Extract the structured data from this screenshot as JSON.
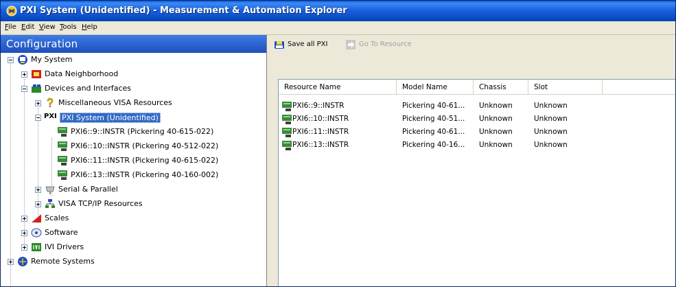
{
  "window": {
    "title": "PXI System (Unidentified) - Measurement & Automation Explorer"
  },
  "menu": {
    "items": [
      {
        "underline": "F",
        "rest": "ile"
      },
      {
        "underline": "E",
        "rest": "dit"
      },
      {
        "underline": "V",
        "rest": "iew"
      },
      {
        "underline": "T",
        "rest": "ools"
      },
      {
        "underline": "H",
        "rest": "elp"
      }
    ]
  },
  "config": {
    "header": "Configuration"
  },
  "toolbar": {
    "save_label": "Save all PXI",
    "goto_label": "Go To Resource"
  },
  "tree": {
    "items": [
      {
        "label": "My System",
        "icon": "computer-icon"
      },
      {
        "label": "Data Neighborhood",
        "icon": "data-neighborhood-icon"
      },
      {
        "label": "Devices and Interfaces",
        "icon": "devices-icon"
      },
      {
        "label": "Miscellaneous VISA Resources",
        "icon": "question-icon"
      },
      {
        "label": "PXI System (Unidentified)",
        "icon": "pxi-icon"
      },
      {
        "label": "PXI6::9::INSTR (Pickering 40-615-022)",
        "icon": "pxi-module-icon"
      },
      {
        "label": "PXI6::10::INSTR (Pickering 40-512-022)",
        "icon": "pxi-module-icon"
      },
      {
        "label": "PXI6::11::INSTR (Pickering 40-615-022)",
        "icon": "pxi-module-icon"
      },
      {
        "label": "PXI6::13::INSTR (Pickering 40-160-002)",
        "icon": "pxi-module-icon"
      },
      {
        "label": "Serial & Parallel",
        "icon": "serial-icon"
      },
      {
        "label": "VISA TCP/IP Resources",
        "icon": "network-icon"
      },
      {
        "label": "Scales",
        "icon": "scales-icon"
      },
      {
        "label": "Software",
        "icon": "software-icon"
      },
      {
        "label": "IVI Drivers",
        "icon": "ivi-icon"
      },
      {
        "label": "Remote Systems",
        "icon": "remote-icon"
      }
    ]
  },
  "list": {
    "columns": [
      "Resource Name",
      "Model Name",
      "Chassis",
      "Slot"
    ],
    "rows": [
      [
        "PXI6::9::INSTR",
        "Pickering 40-61...",
        "Unknown",
        "Unknown"
      ],
      [
        "PXI6::10::INSTR",
        "Pickering 40-51...",
        "Unknown",
        "Unknown"
      ],
      [
        "PXI6::11::INSTR",
        "Pickering 40-61...",
        "Unknown",
        "Unknown"
      ],
      [
        "PXI6::13::INSTR",
        "Pickering 40-16...",
        "Unknown",
        "Unknown"
      ]
    ]
  },
  "colors": {
    "title_bar": "#0a4fc8",
    "selection": "#316ac5",
    "config_header": "#2c64d0"
  }
}
